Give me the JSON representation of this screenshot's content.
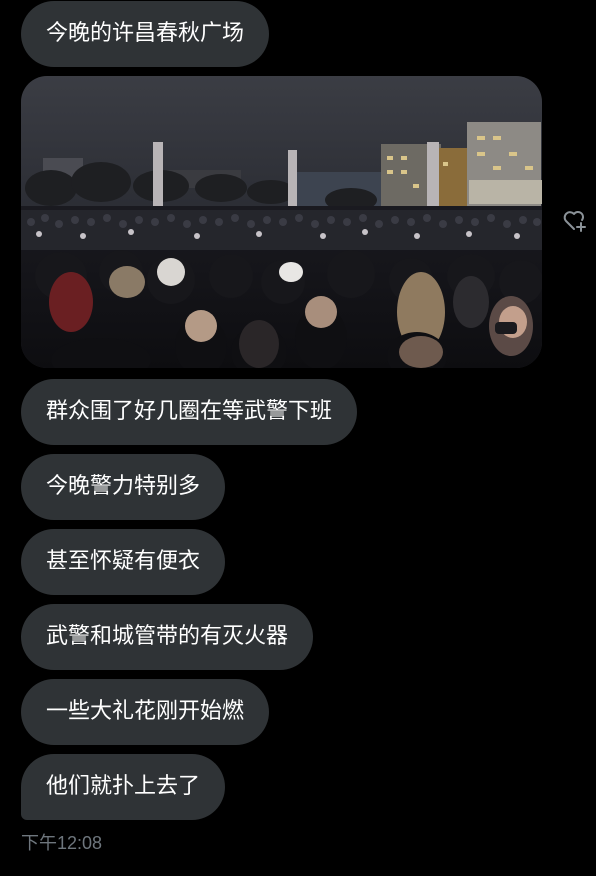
{
  "messages": [
    {
      "text": "今晚的许昌春秋广场"
    },
    {
      "text": "群众围了好几圈在等武警下班"
    },
    {
      "text": "今晚警力特别多"
    },
    {
      "text": "甚至怀疑有便衣"
    },
    {
      "text": "武警和城管带的有灭火器"
    },
    {
      "text": "一些大礼花刚开始燃"
    },
    {
      "text": "他们就扑上去了"
    }
  ],
  "timestamp": "下午12:08",
  "icons": {
    "reaction": "heart-plus-icon"
  },
  "colors": {
    "background": "#000000",
    "bubble": "#2f3336",
    "text": "#ffffff",
    "timestamp": "#6e767d"
  }
}
